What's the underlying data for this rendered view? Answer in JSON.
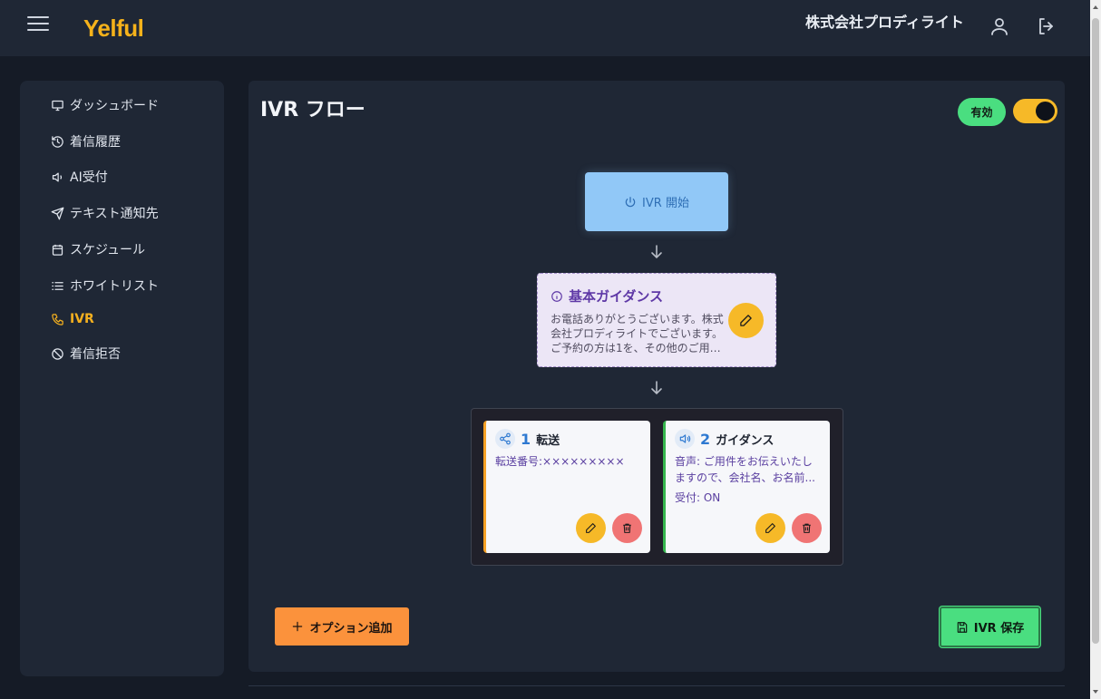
{
  "header": {
    "logo_text": "Yelful",
    "company_name": "株式会社プロディライト"
  },
  "sidebar": {
    "items": [
      {
        "label": "ダッシュボード",
        "icon": "monitor-icon"
      },
      {
        "label": "着信履歴",
        "icon": "history-icon"
      },
      {
        "label": "AI受付",
        "icon": "speaker-icon"
      },
      {
        "label": "テキスト通知先",
        "icon": "send-icon"
      },
      {
        "label": "スケジュール",
        "icon": "calendar-icon"
      },
      {
        "label": "ホワイトリスト",
        "icon": "list-icon"
      },
      {
        "label": "IVR",
        "icon": "phone-icon",
        "active": true
      },
      {
        "label": "着信拒否",
        "icon": "ban-icon"
      }
    ]
  },
  "main": {
    "title": "IVR フロー",
    "status_badge": "有効",
    "toggle_on": true,
    "start_node": {
      "label": "IVR 開始"
    },
    "guidance": {
      "title": "基本ガイダンス",
      "lines": [
        "お電話ありがとうございます。株式",
        "会社プロディライトでございます。",
        "ご予約の方は1を、その他のご用件..."
      ]
    },
    "options": [
      {
        "number": "1",
        "label": "転送",
        "line1": "転送番号:×××××××××",
        "line2": "",
        "line3": ""
      },
      {
        "number": "2",
        "label": "ガイダンス",
        "line1": "音声: ご用件をお伝えいたし",
        "line2": "ますので、会社名、お名前...",
        "line3": "受付: ON"
      }
    ],
    "add_option_label": "オプション追加",
    "save_label": "IVR 保存"
  },
  "colors": {
    "accent": "#f6b928",
    "active_badge": "#4ade80",
    "start_node": "#91c8f7",
    "guidance_bg": "#ece6f6",
    "add_button": "#fb923c"
  }
}
